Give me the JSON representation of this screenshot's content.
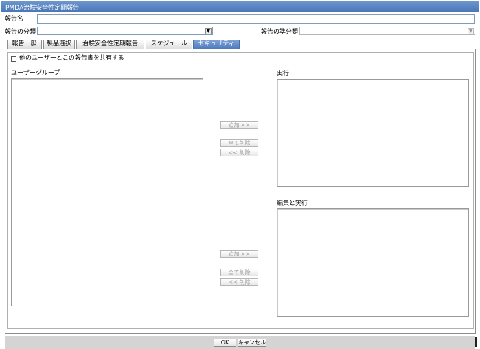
{
  "window": {
    "title": "PMDA治験安全性定期報告"
  },
  "form": {
    "report_name_label": "報告名",
    "report_name_value": "",
    "classification_label": "報告の分類",
    "classification_value": "",
    "sub_classification_label": "報告の準分類",
    "sub_classification_value": ""
  },
  "tabs": [
    {
      "label": "報告一般"
    },
    {
      "label": "製品選択"
    },
    {
      "label": "治験安全性定期報告"
    },
    {
      "label": "スケジュール"
    },
    {
      "label": "セキュリティ"
    }
  ],
  "security": {
    "share_label": "他のユーザーとこの報告書を共有する",
    "share_checked": false,
    "user_group_label": "ユーザーグループ",
    "execute_label": "実行",
    "edit_execute_label": "編集と実行",
    "add_label": "追加 >>",
    "remove_all_label": "全て削除",
    "remove_label": "<< 削除"
  },
  "footer": {
    "ok_label": "OK",
    "cancel_label": "キャンセル"
  }
}
